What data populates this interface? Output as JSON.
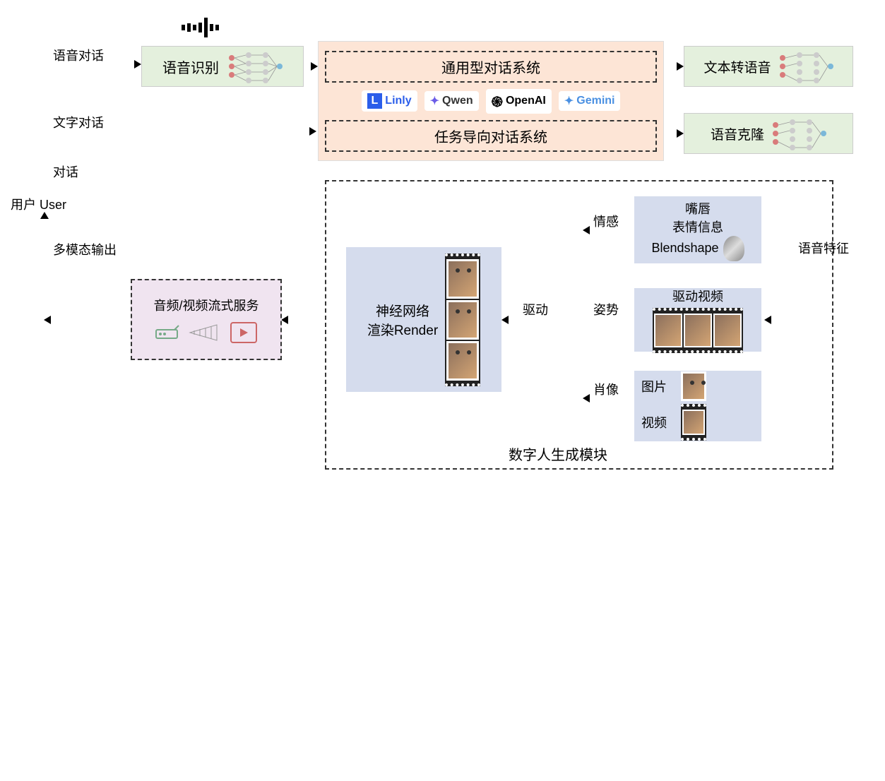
{
  "user": {
    "label_cn": "用户",
    "label_en": "User"
  },
  "edges": {
    "voice_dialog": "语音对话",
    "text_dialog": "文字对话",
    "dialog": "对话",
    "multimodal_output": "多模态输出",
    "emotion": "情感",
    "pose": "姿势",
    "portrait": "肖像",
    "drive": "驱动",
    "speech_features": "语音特征"
  },
  "nodes": {
    "asr": "语音识别",
    "general_dialog": "通用型对话系统",
    "task_dialog": "任务导向对话系统",
    "tts": "文本转语音",
    "voice_clone": "语音克隆",
    "streaming": "音频/视频流式服务",
    "renderer_l1": "神经网络",
    "renderer_l2": "渲染Render",
    "blendshape_l1": "嘴唇",
    "blendshape_l2": "表情信息",
    "blendshape_l3": "Blendshape",
    "drive_video": "驱动视频",
    "image": "图片",
    "video": "视频",
    "avatar_module": "数字人生成模块"
  },
  "logos": {
    "linly": "Linly",
    "qwen": "Qwen",
    "openai": "OpenAI",
    "gemini": "Gemini"
  }
}
